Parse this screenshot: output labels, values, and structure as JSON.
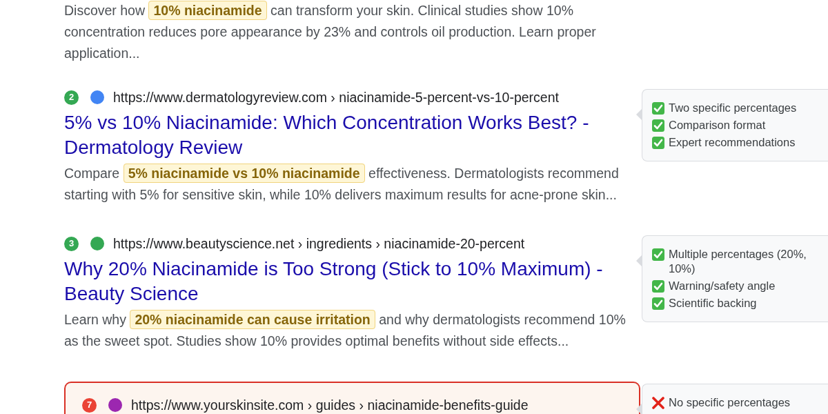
{
  "results": [
    {
      "flagged": false,
      "snippet": {
        "before": "Discover how",
        "highlight": "10% niacinamide",
        "after": "can transform your skin. Clinical studies show 10% concentration reduces pore appearance by 23% and controls oil production. Learn proper application..."
      }
    },
    {
      "flagged": false,
      "badge": {
        "text": "2",
        "color": "#34a853"
      },
      "dot": {
        "color": "#4285f4"
      },
      "url": "https://www.dermatologyreview.com › niacinamide-5-percent-vs-10-percent",
      "title": "5% vs 10% Niacinamide: Which Concentration Works Best? - Dermatology Review",
      "snippet": {
        "before": "Compare",
        "highlight": "5% niacinamide vs 10% niacinamide",
        "after": "effectiveness. Dermatologists recommend starting with 5% for sensitive skin, while 10% delivers maximum results for acne-prone skin..."
      },
      "notes": [
        {
          "kind": "check",
          "text": "Two specific percentages"
        },
        {
          "kind": "check",
          "text": "Comparison format"
        },
        {
          "kind": "check",
          "text": "Expert recommendations"
        }
      ]
    },
    {
      "flagged": false,
      "badge": {
        "text": "3",
        "color": "#34a853"
      },
      "dot": {
        "color": "#34a853"
      },
      "url": "https://www.beautyscience.net › ingredients › niacinamide-20-percent",
      "title": "Why 20% Niacinamide is Too Strong (Stick to 10% Maximum) - Beauty Science",
      "snippet": {
        "before": "Learn why",
        "highlight": "20% niacinamide can cause irritation",
        "after": "and why dermatologists recommend 10% as the sweet spot. Studies show 10% provides optimal benefits without side effects..."
      },
      "notes": [
        {
          "kind": "check",
          "text": "Multiple percentages (20%, 10%)"
        },
        {
          "kind": "check",
          "text": "Warning/safety angle"
        },
        {
          "kind": "check",
          "text": "Scientific backing"
        }
      ]
    },
    {
      "flagged": true,
      "badge": {
        "text": "7",
        "color": "#ea4335"
      },
      "dot": {
        "color": "#9c27b0"
      },
      "url": "https://www.yourskinsite.com › guides › niacinamide-benefits-guide",
      "notes": [
        {
          "kind": "cross",
          "text": "No specific percentages"
        }
      ]
    }
  ]
}
